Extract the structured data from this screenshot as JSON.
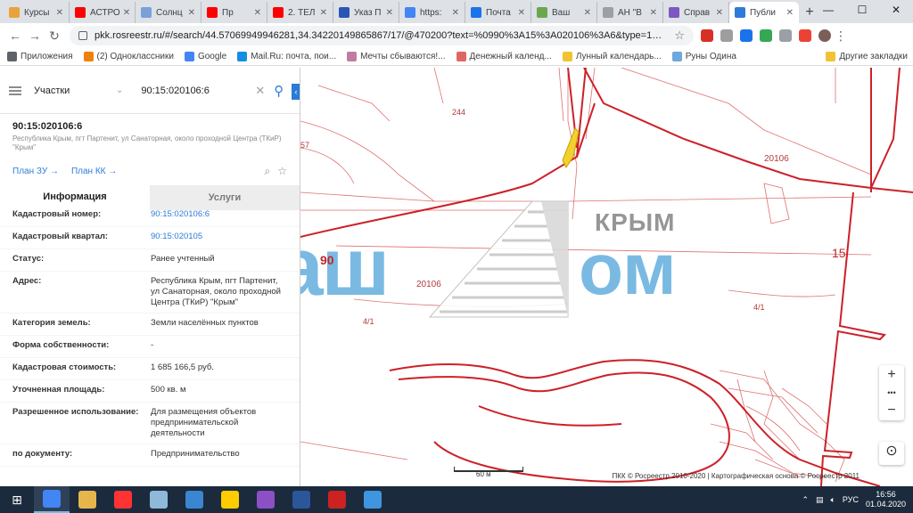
{
  "browser": {
    "tabs": [
      {
        "label": "Курсы",
        "color": "#e8a33c"
      },
      {
        "label": "АСТРО",
        "color": "#ff0000"
      },
      {
        "label": "Солнц",
        "color": "#7aa0d8"
      },
      {
        "label": "Пр",
        "color": "#ff0000"
      },
      {
        "label": "2. ТЕЛ",
        "color": "#ff0000"
      },
      {
        "label": "Указ П",
        "color": "#2b55b5"
      },
      {
        "label": "https:",
        "color": "#4285f4"
      },
      {
        "label": "Почта",
        "color": "#1a73e8"
      },
      {
        "label": "Ваш",
        "color": "#6aa84f"
      },
      {
        "label": "АН \"В",
        "color": "#9aa0a6"
      },
      {
        "label": "Справ",
        "color": "#7e57c2"
      },
      {
        "label": "Публи",
        "color": "#2d7bd6"
      }
    ],
    "new_tab": "+",
    "url": "pkk.rosreestr.ru/#/search/44.57069949946281,34.34220149865867/17/@470200?text=%0990%3A15%3A020106%3A6&type=1&opened=...",
    "window_controls": [
      "—",
      "☐",
      "✕"
    ]
  },
  "bookmarks": [
    {
      "label": "Приложения",
      "color": "#5f6368"
    },
    {
      "label": "(2) Одноклассники",
      "color": "#ee8208"
    },
    {
      "label": "Google",
      "color": "#4285f4"
    },
    {
      "label": "Mail.Ru: почта, пои...",
      "color": "#168de2"
    },
    {
      "label": "Мечты сбываются!...",
      "color": "#c27ba0"
    },
    {
      "label": "Денежный календ...",
      "color": "#e06666"
    },
    {
      "label": "Лунный календарь...",
      "color": "#f1c232"
    },
    {
      "label": "Руны Одина",
      "color": "#6fa8dc"
    }
  ],
  "other_bookmarks": "Другие закладки",
  "search": {
    "type": "Участки",
    "query": "90:15:020106:6"
  },
  "object": {
    "title": "90:15:020106:6",
    "address": "Республика Крым, пгт Партенит, ул Санаторная, около проходной Центра (ТКиР) \"Крым\"",
    "plan_zu": "План ЗУ →",
    "plan_kk": "План КК →"
  },
  "panel_tabs": {
    "info": "Информация",
    "services": "Услуги"
  },
  "info": [
    {
      "k": "Кадастровый номер:",
      "v": "90:15:020106:6",
      "link": true
    },
    {
      "k": "Кадастровый квартал:",
      "v": "90:15:020105",
      "link": true
    },
    {
      "k": "Статус:",
      "v": "Ранее учтенный",
      "link": false
    },
    {
      "k": "Адрес:",
      "v": "Республика Крым, пгт Партенит, ул Санаторная, около проходной Центра (ТКиР) \"Крым\"",
      "link": false
    },
    {
      "k": "Категория земель:",
      "v": "Земли населённых пунктов",
      "link": false
    },
    {
      "k": "Форма собственности:",
      "v": "-",
      "link": false
    },
    {
      "k": "Кадастровая стоимость:",
      "v": "1 685 166,5 руб.",
      "link": false
    },
    {
      "k": "Уточненная площадь:",
      "v": "500 кв. м",
      "link": false
    },
    {
      "k": "Разрешенное использование:",
      "v": "Для размещения объектов предпринимательской деятельности",
      "link": false
    },
    {
      "k": "по документу:",
      "v": "Предпринимательство",
      "link": false
    }
  ],
  "map": {
    "labels": [
      "244",
      "57",
      "20106",
      "90",
      "20106",
      "4/1",
      "4/1",
      "15"
    ],
    "watermark_main": "Ваш",
    "watermark_end": "ом",
    "watermark_region": "КРЫМ",
    "scale": "60 м",
    "copyright": "ПКК © Росреестр 2010-2020 | Картографическая основа © Росреестр 2011",
    "zoom_in": "+",
    "zoom_more": "•••",
    "zoom_out": "−",
    "compass": "⊙"
  },
  "taskbar": {
    "apps": [
      "#4285f4",
      "#e6b64c",
      "#ff3333",
      "#8fb9d8",
      "#3a86d1",
      "#ffcc00",
      "#8c4fc5",
      "#2b579a",
      "#cc2222",
      "#3f95e0"
    ],
    "lang": "РУС",
    "time": "16:56",
    "date": "01.04.2020"
  }
}
